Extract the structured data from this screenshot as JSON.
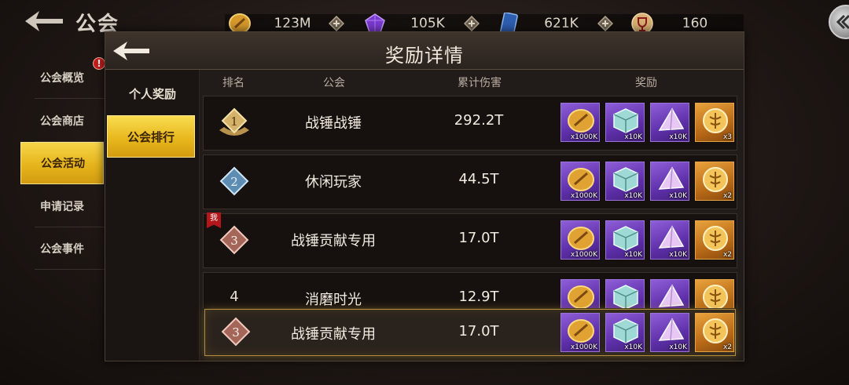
{
  "header": {
    "title": "公会"
  },
  "currencies": [
    {
      "icon": "gold-coin-icon",
      "value": "123M"
    },
    {
      "icon": "purple-gem-icon",
      "value": "105K"
    },
    {
      "icon": "blue-card-icon",
      "value": "621K"
    },
    {
      "icon": "trophy-cup-icon",
      "value": "160"
    }
  ],
  "sidebar": {
    "items": [
      {
        "label": "公会概览",
        "badge": "!"
      },
      {
        "label": "公会商店"
      },
      {
        "label": "公会活动",
        "active": true
      },
      {
        "label": "申请记录"
      },
      {
        "label": "公会事件"
      }
    ]
  },
  "panel": {
    "title": "奖励详情",
    "tabs": [
      {
        "label": "个人奖励"
      },
      {
        "label": "公会排行",
        "active": true
      }
    ],
    "columns": {
      "rank": "排名",
      "guild": "公会",
      "damage": "累计伤害",
      "reward": "奖励"
    },
    "rows": [
      {
        "rank": "1",
        "guild": "战锤战锤",
        "damage": "292.2T",
        "rewards": [
          {
            "type": "coin",
            "qty": "x1000K"
          },
          {
            "type": "cube",
            "qty": "x10K"
          },
          {
            "type": "crystal",
            "qty": "x10K"
          },
          {
            "type": "medal",
            "qty": "x3"
          }
        ]
      },
      {
        "rank": "2",
        "guild": "休闲玩家",
        "damage": "44.5T",
        "rewards": [
          {
            "type": "coin",
            "qty": "x1000K"
          },
          {
            "type": "cube",
            "qty": "x10K"
          },
          {
            "type": "crystal",
            "qty": "x10K"
          },
          {
            "type": "medal",
            "qty": "x2"
          }
        ]
      },
      {
        "rank": "3",
        "guild": "战锤贡献专用",
        "damage": "17.0T",
        "me_tag": "我",
        "rewards": [
          {
            "type": "coin",
            "qty": "x1000K"
          },
          {
            "type": "cube",
            "qty": "x10K"
          },
          {
            "type": "crystal",
            "qty": "x10K"
          },
          {
            "type": "medal",
            "qty": "x2"
          }
        ]
      },
      {
        "rank": "4",
        "guild": "消磨时光",
        "damage": "12.9T",
        "rewards": [
          {
            "type": "coin",
            "qty": ""
          },
          {
            "type": "cube",
            "qty": ""
          },
          {
            "type": "crystal",
            "qty": ""
          },
          {
            "type": "medal",
            "qty": ""
          }
        ]
      }
    ],
    "my_row": {
      "rank": "3",
      "guild": "战锤贡献专用",
      "damage": "17.0T",
      "rewards": [
        {
          "type": "coin",
          "qty": "x1000K"
        },
        {
          "type": "cube",
          "qty": "x10K"
        },
        {
          "type": "crystal",
          "qty": "x10K"
        },
        {
          "type": "medal",
          "qty": "x2"
        }
      ]
    }
  },
  "colors": {
    "accent_gold": "#e8b81e",
    "reward_purple": "#6a3bb8",
    "reward_orange": "#c27a1e",
    "panel_bg": "#211c19"
  }
}
